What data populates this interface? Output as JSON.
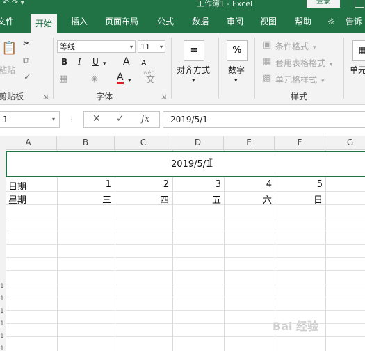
{
  "window": {
    "title": "工作簿1 - Excel",
    "login_label": "登录"
  },
  "tabs": [
    {
      "label": "文件"
    },
    {
      "label": "开始"
    },
    {
      "label": "插入"
    },
    {
      "label": "页面布局"
    },
    {
      "label": "公式"
    },
    {
      "label": "数据"
    },
    {
      "label": "审阅"
    },
    {
      "label": "视图"
    },
    {
      "label": "帮助"
    },
    {
      "label": "告诉"
    }
  ],
  "ribbon": {
    "clipboard": {
      "paste_label": "粘贴",
      "group_label": "剪贴板"
    },
    "font": {
      "name": "等线",
      "size": "11",
      "group_label": "字体",
      "bold": "B",
      "italic": "I",
      "underline": "U",
      "grow": "A",
      "shrink": "A",
      "color_a": "A",
      "phonetic": "wén"
    },
    "alignment": {
      "label": "对齐方式"
    },
    "number": {
      "label": "数字",
      "icon_text": "%"
    },
    "styles": {
      "conditional": "条件格式",
      "table_format": "套用表格格式",
      "cell_styles": "单元格样式",
      "group_label": "样式"
    },
    "cells": {
      "label": "单元"
    }
  },
  "formula_bar": {
    "name_box": "1",
    "value": "2019/5/1"
  },
  "sheet": {
    "columns": [
      "A",
      "B",
      "C",
      "D",
      "E",
      "F",
      "G"
    ],
    "merged_value": "2019/5/1",
    "row1": {
      "label": "日期",
      "values": [
        "1",
        "2",
        "3",
        "4",
        "5"
      ]
    },
    "row2": {
      "label": "星期",
      "values": [
        "三",
        "四",
        "五",
        "六",
        "日"
      ]
    },
    "row_numbers": [
      "1",
      "1",
      "1",
      "1",
      "1",
      "1",
      "1",
      "1",
      "1"
    ]
  },
  "watermark": "Bai 经验"
}
